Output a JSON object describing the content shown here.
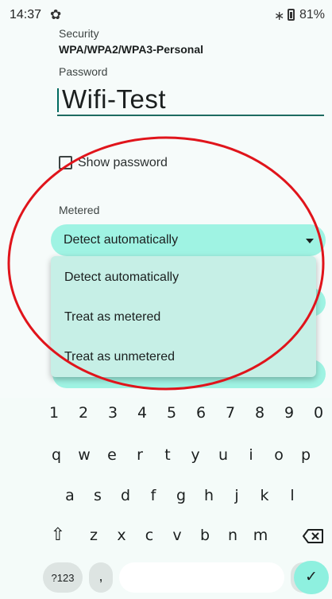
{
  "status_bar": {
    "time": "14:37",
    "gear_icon": "settings-gear-icon",
    "bluetooth_icon": "bluetooth-icon",
    "battery": "81%"
  },
  "security": {
    "label": "Security",
    "value": "WPA/WPA2/WPA3-Personal"
  },
  "password": {
    "label": "Password",
    "value": "Wifi-Test"
  },
  "show_password": {
    "label": "Show password",
    "checked": false
  },
  "metered": {
    "label": "Metered",
    "selected": "Detect automatically",
    "options": [
      "Detect automatically",
      "Treat as metered",
      "Treat as unmetered"
    ]
  },
  "keyboard": {
    "numbers": [
      "1",
      "2",
      "3",
      "4",
      "5",
      "6",
      "7",
      "8",
      "9",
      "0"
    ],
    "row1": [
      "q",
      "w",
      "e",
      "r",
      "t",
      "y",
      "u",
      "i",
      "o",
      "p"
    ],
    "row2": [
      "a",
      "s",
      "d",
      "f",
      "g",
      "h",
      "j",
      "k",
      "l"
    ],
    "row3": [
      "z",
      "x",
      "c",
      "v",
      "b",
      "n",
      "m"
    ],
    "symbols": "?123",
    "comma": ",",
    "period": ".",
    "done_icon": "check-icon"
  },
  "annotation_color": "#e0141b"
}
